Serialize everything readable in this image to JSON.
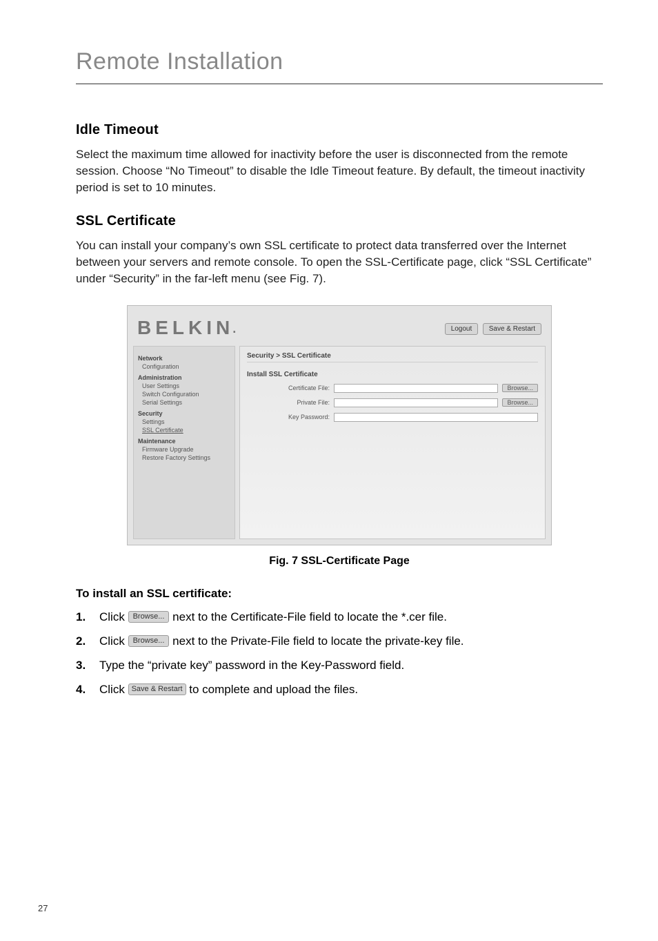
{
  "page_title": "Remote Installation",
  "idle": {
    "heading": "Idle Timeout",
    "para": "Select the maximum time allowed for inactivity before the user is disconnected from the remote session. Choose “No Timeout” to disable the Idle Timeout feature. By default, the timeout inactivity period is set to 10 minutes."
  },
  "ssl": {
    "heading": "SSL Certificate",
    "para": "You can install your company’s own SSL certificate to protect data transferred over the Internet between your servers and remote console. To open the SSL-Certificate page, click “SSL Certificate” under “Security” in the far-left menu (see Fig. 7)."
  },
  "shot": {
    "brand": "BELKIN",
    "brand_dot": ".",
    "logout": "Logout",
    "save_restart": "Save & Restart",
    "sidebar": {
      "network": "Network",
      "configuration": "Configuration",
      "administration": "Administration",
      "user_settings": "User Settings",
      "switch_conf": "Switch Configuration",
      "serial_settings": "Serial Settings",
      "security": "Security",
      "settings": "Settings",
      "ssl_cert": "SSL Certificate",
      "maintenance": "Maintenance",
      "fw_upgrade": "Firmware Upgrade",
      "restore": "Restore Factory Settings"
    },
    "content": {
      "crumb": "Security > SSL Certificate",
      "sub": "Install SSL Certificate",
      "cert_file_lbl": "Certificate File:",
      "priv_file_lbl": "Private File:",
      "key_pw_lbl": "Key Password:",
      "browse": "Browse..."
    }
  },
  "fig_caption": "Fig. 7 SSL-Certificate Page",
  "steps": {
    "title": "To install an SSL certificate:",
    "s1_a": "Click ",
    "s1_btn": "Browse...",
    "s1_b": " next to the Certificate-File field to locate the *.cer file.",
    "s2_a": "Click ",
    "s2_btn": "Browse...",
    "s2_b": " next to the Private-File field to locate the private-key file.",
    "s3": "Type the “private key” password in the Key-Password field.",
    "s4_a": "Click ",
    "s4_btn": "Save & Restart",
    "s4_b": " to complete and upload the files."
  },
  "numbers": {
    "n1": "1.",
    "n2": "2.",
    "n3": "3.",
    "n4": "4."
  },
  "page_number": "27"
}
